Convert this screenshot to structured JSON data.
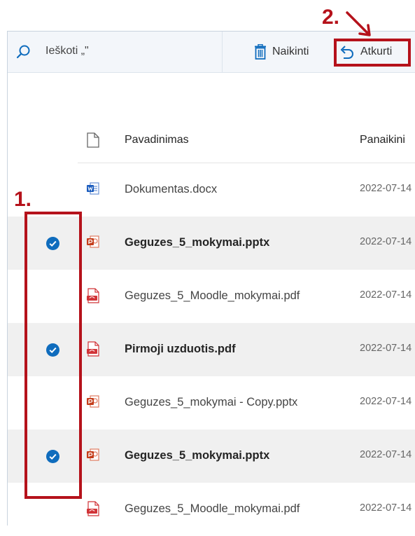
{
  "toolbar": {
    "search_label": "Ieškoti „\"",
    "delete_label": "Naikinti",
    "restore_label": "Atkurti"
  },
  "columns": {
    "name": "Pavadinimas",
    "deleted": "Panaikini"
  },
  "files": [
    {
      "name": "Dokumentas.docx",
      "date": "2022-07-14",
      "type": "word",
      "selected": false
    },
    {
      "name": "Geguzes_5_mokymai.pptx",
      "date": "2022-07-14",
      "type": "pptx",
      "selected": true
    },
    {
      "name": "Geguzes_5_Moodle_mokymai.pdf",
      "date": "2022-07-14",
      "type": "pdf",
      "selected": false
    },
    {
      "name": "Pirmoji uzduotis.pdf",
      "date": "2022-07-14",
      "type": "pdf",
      "selected": true
    },
    {
      "name": "Geguzes_5_mokymai - Copy.pptx",
      "date": "2022-07-14",
      "type": "pptx",
      "selected": false
    },
    {
      "name": "Geguzes_5_mokymai.pptx",
      "date": "2022-07-14",
      "type": "pptx",
      "selected": true
    },
    {
      "name": "Geguzes_5_Moodle_mokymai.pdf",
      "date": "2022-07-14",
      "type": "pdf",
      "selected": false
    }
  ],
  "annotations": {
    "step1": "1.",
    "step2": "2.",
    "color": "#b5121b"
  },
  "colors": {
    "accent": "#0f6cbd",
    "word": "#185abd",
    "pptx": "#c43e1c",
    "pdf": "#d13438"
  }
}
